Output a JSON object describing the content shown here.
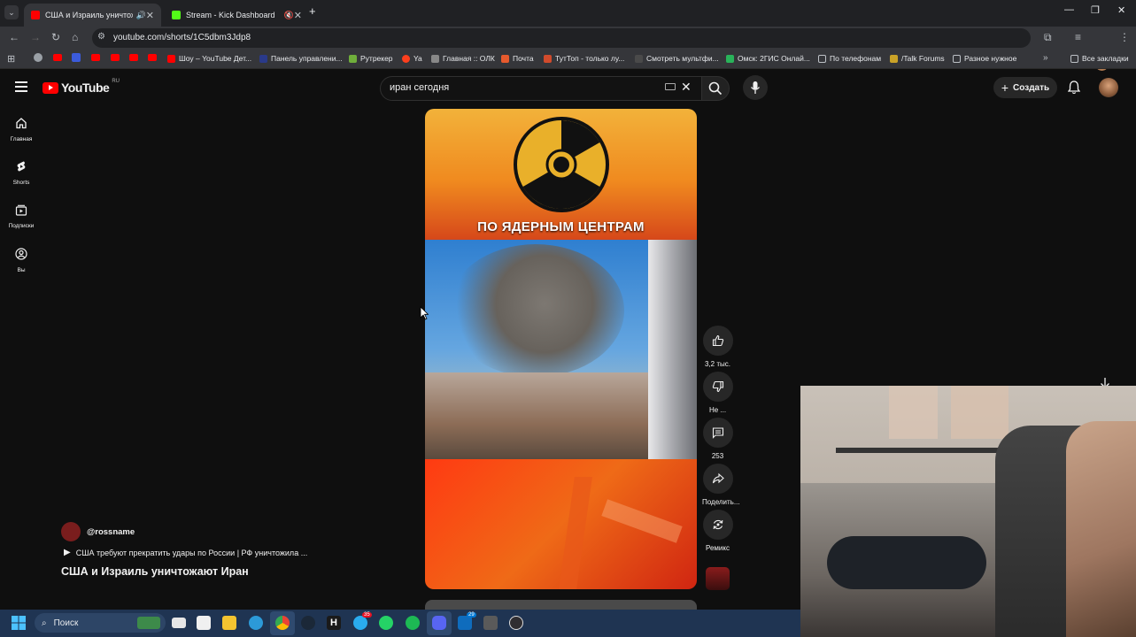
{
  "browser": {
    "tabs": [
      {
        "title": "США и Израиль уничтож",
        "active": true
      },
      {
        "title": "Stream - Kick Dashboard",
        "active": false
      }
    ],
    "url": "youtube.com/shorts/1C5dbm3Jdp8",
    "bookmarks": [
      "Шоу – YouTube Дет...",
      "Панель управлени...",
      "Рутрекер",
      "Ya",
      "Главная :: ОЛК",
      "Почта",
      "ТутТоп - только лу...",
      "Смотреть мультфи...",
      "Омск: 2ГИС Онлай...",
      "По телефонам",
      "/Talk Forums",
      "Разное нужное"
    ],
    "all_bookmarks": "Все закладки"
  },
  "youtube": {
    "logo": "YouTube",
    "region": "RU",
    "search_query": "иран сегодня",
    "create_label": "Создать",
    "guide": [
      {
        "label": "Главная",
        "icon": "home-icon"
      },
      {
        "label": "Shorts",
        "icon": "shorts-icon"
      },
      {
        "label": "Подписки",
        "icon": "subscriptions-icon"
      },
      {
        "label": "Вы",
        "icon": "you-icon"
      }
    ],
    "video_caption": "ПО ЯДЕРНЫМ ЦЕНТРАМ",
    "actions": {
      "likes": "3,2 тыс.",
      "dislike": "Не ...",
      "comments": "253",
      "share": "Поделить...",
      "remix": "Ремикс"
    },
    "channel": "@rossname",
    "linked_video": "США требуют прекратить удары по России | РФ уничтожила ...",
    "title": "США и Израиль уничтожают Иран"
  },
  "taskbar": {
    "search_label": "Поиск",
    "badge_telegram": "35",
    "badge_mail": "29"
  }
}
